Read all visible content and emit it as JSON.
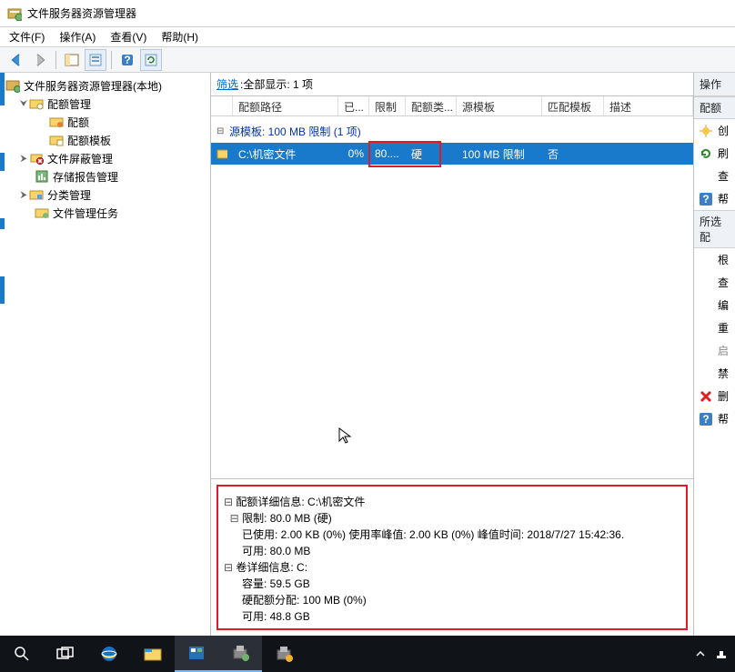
{
  "window": {
    "title": "文件服务器资源管理器"
  },
  "menu": {
    "file": "文件(F)",
    "action": "操作(A)",
    "view": "查看(V)",
    "help": "帮助(H)"
  },
  "tree": {
    "root": "文件服务器资源管理器(本地)",
    "quota_mgmt": "配额管理",
    "quota": "配额",
    "quota_tpl": "配额模板",
    "file_screen_mgmt": "文件屏蔽管理",
    "storage_reports": "存储报告管理",
    "classification": "分类管理",
    "file_tasks": "文件管理任务"
  },
  "filter": {
    "link": "筛选",
    "text": ":全部显示: 1 项"
  },
  "columns": {
    "path": "配额路径",
    "used": "已...",
    "limit": "限制",
    "type": "配额类...",
    "src_tpl": "源模板",
    "match_tpl": "匹配模板",
    "desc": "描述"
  },
  "group": {
    "label": "源模板: 100 MB 限制 (1 项)"
  },
  "row": {
    "path": "C:\\机密文件",
    "used": "0%",
    "limit": "80....",
    "type": "硬",
    "src_tpl": "100 MB 限制",
    "match_tpl": "否"
  },
  "details": {
    "l1": "配额详细信息: C:\\机密文件",
    "l2": "限制: 80.0 MB (硬)",
    "l3": "已使用: 2.00 KB (0%) 使用率峰值: 2.00 KB (0%) 峰值时间: 2018/7/27 15:42:36.",
    "l4": "可用: 80.0 MB",
    "l5": "卷详细信息: C:",
    "l6": "容量: 59.5 GB",
    "l7": "硬配额分配: 100 MB (0%)",
    "l8": "可用: 48.8 GB"
  },
  "actions": {
    "header": "操作",
    "sub1": "配额",
    "create": "创",
    "refresh": "刷",
    "view": "查",
    "help": "帮",
    "sub2": "所选配",
    "by_root": "根",
    "view2": "查",
    "edit": "编",
    "reset": "重",
    "enable": "启",
    "disable": "禁",
    "delete": "删",
    "help2": "帮"
  }
}
